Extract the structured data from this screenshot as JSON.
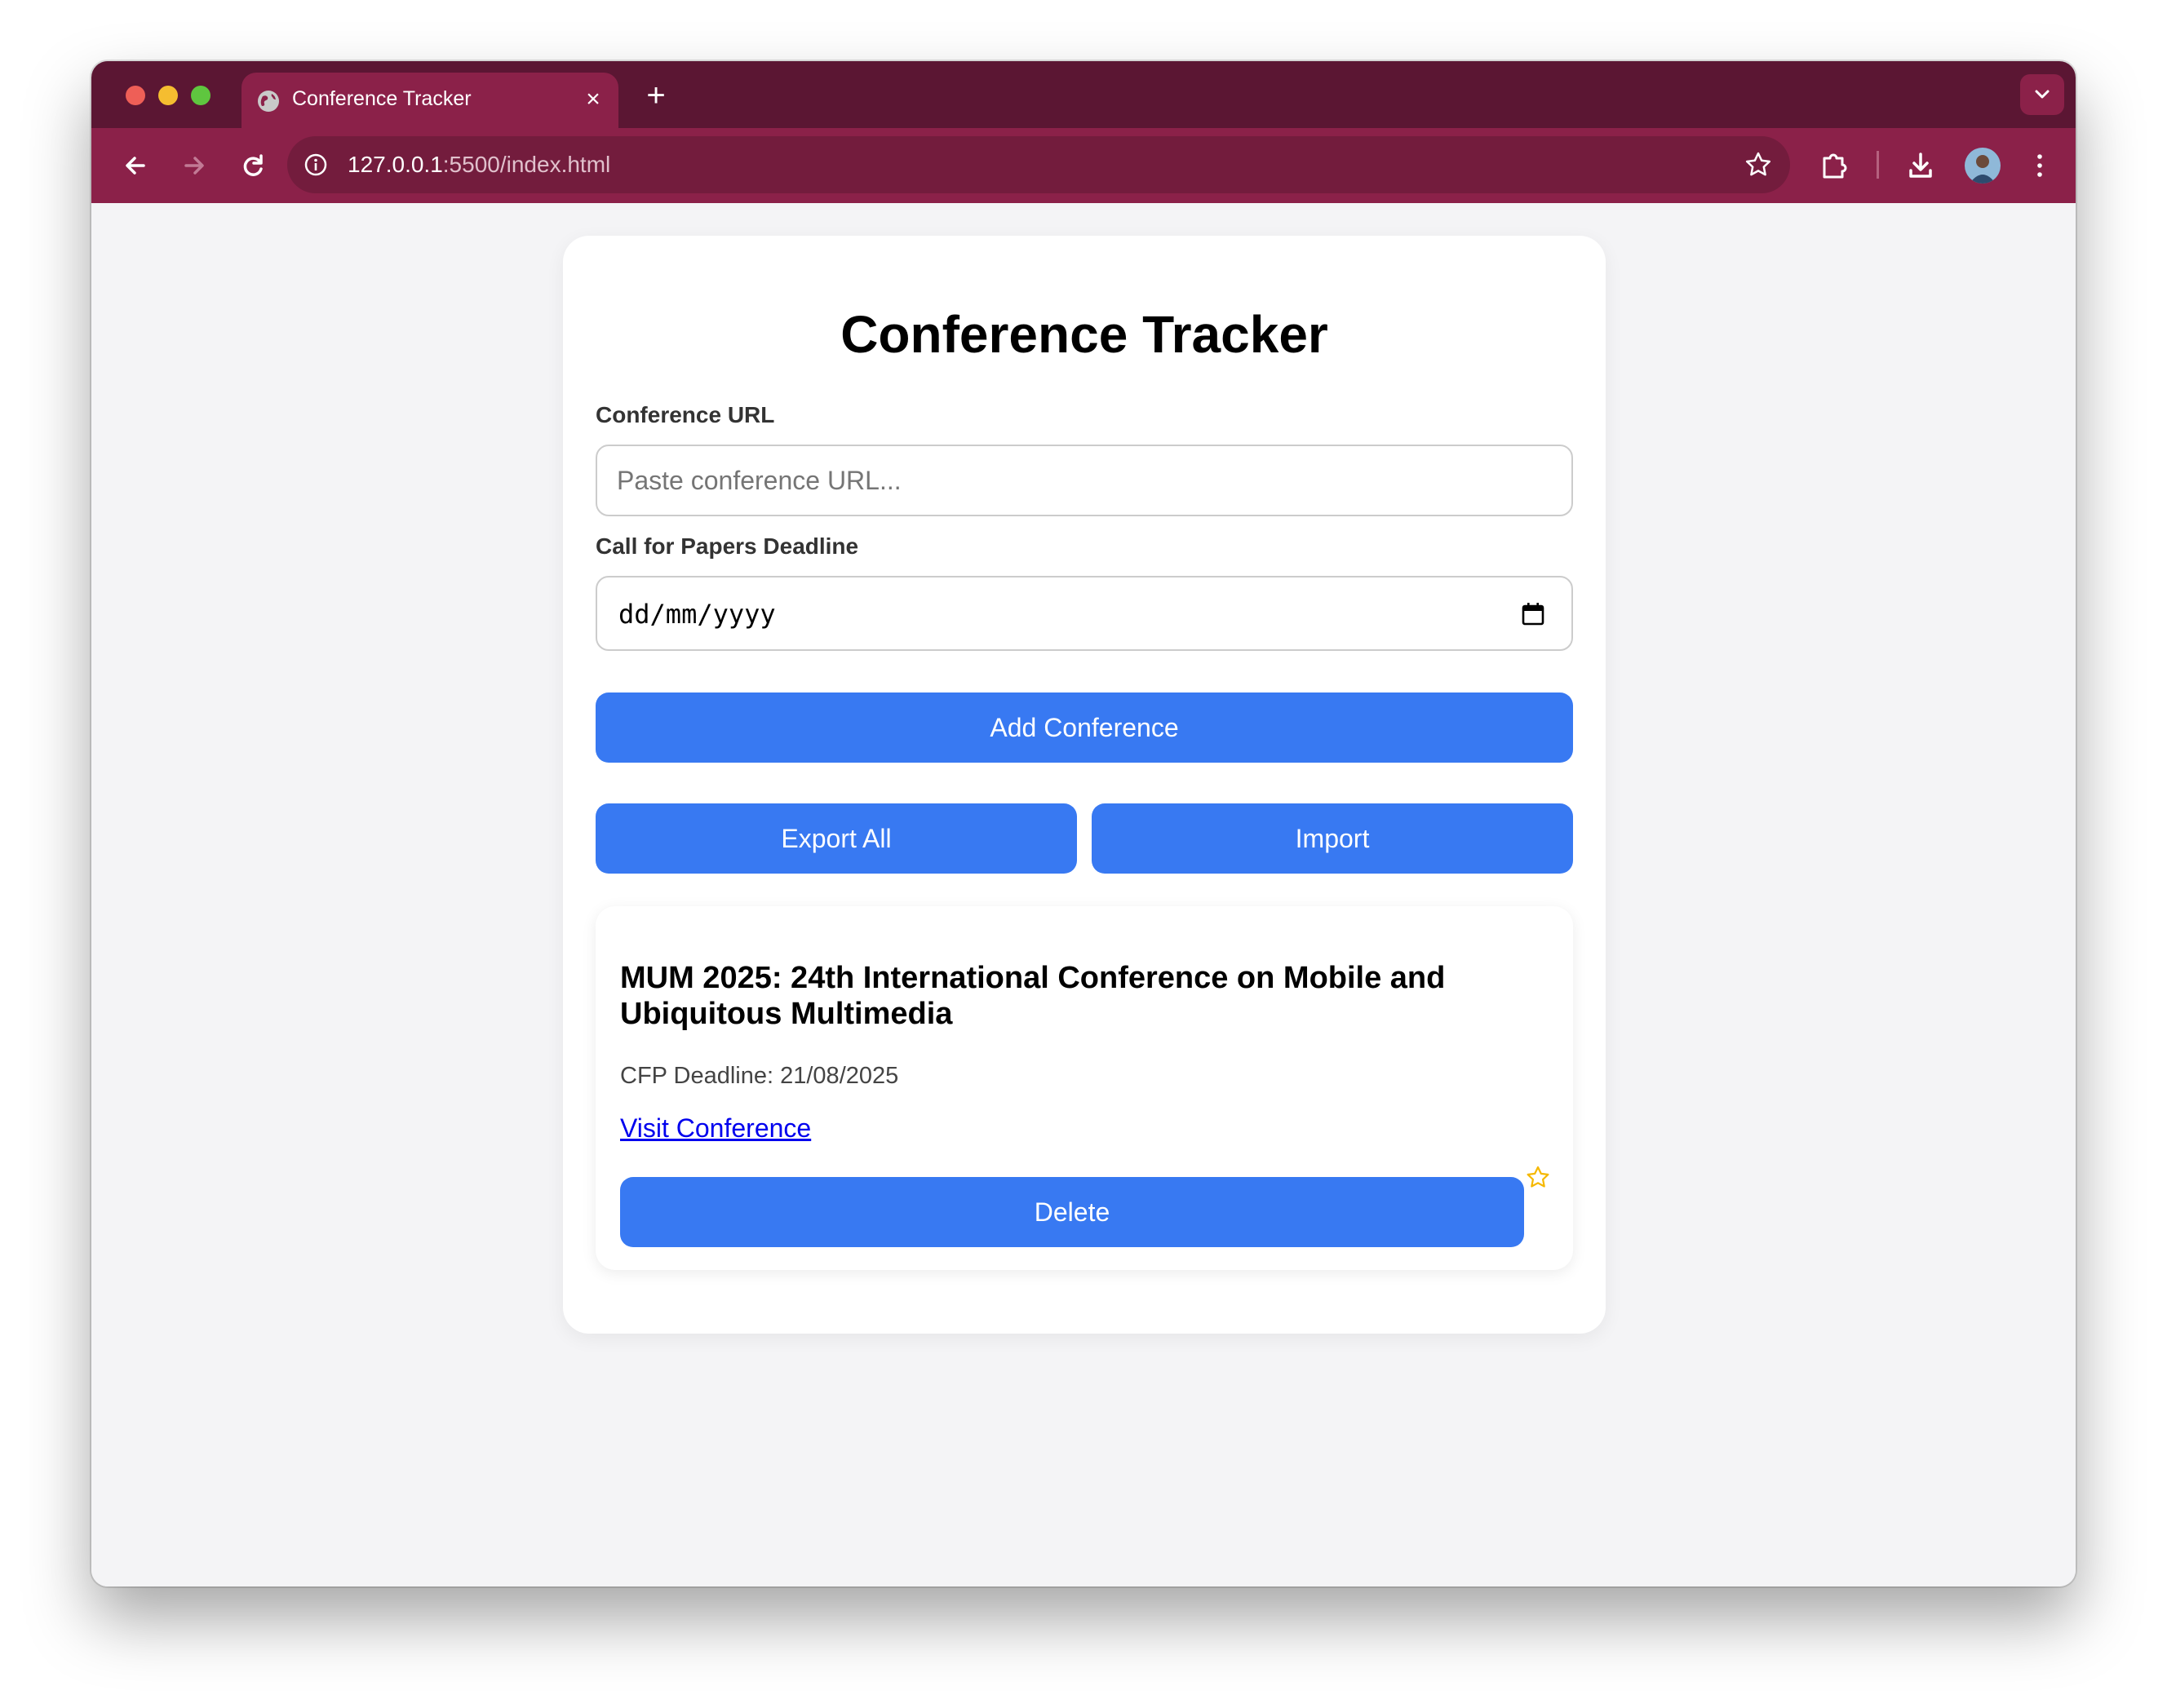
{
  "browser": {
    "tab_title": "Conference Tracker",
    "url_host": "127.0.0.1",
    "url_path": ":5500/index.html"
  },
  "page": {
    "title": "Conference Tracker",
    "url_label": "Conference URL",
    "url_placeholder": "Paste conference URL...",
    "deadline_label": "Call for Papers Deadline",
    "deadline_placeholder": "dd/mm/yyyy",
    "add_button": "Add Conference",
    "export_button": "Export All",
    "import_button": "Import"
  },
  "conferences": [
    {
      "title": "MUM 2025: 24th International Conference on Mobile and Ubiquitous Multimedia",
      "deadline": "CFP Deadline: 21/08/2025",
      "link_text": "Visit Conference",
      "delete_button": "Delete"
    }
  ],
  "colors": {
    "tabbar": "#5b1633",
    "toolbar": "#8b2149",
    "button": "#3879f2",
    "favorite_star": "#f5b800"
  }
}
